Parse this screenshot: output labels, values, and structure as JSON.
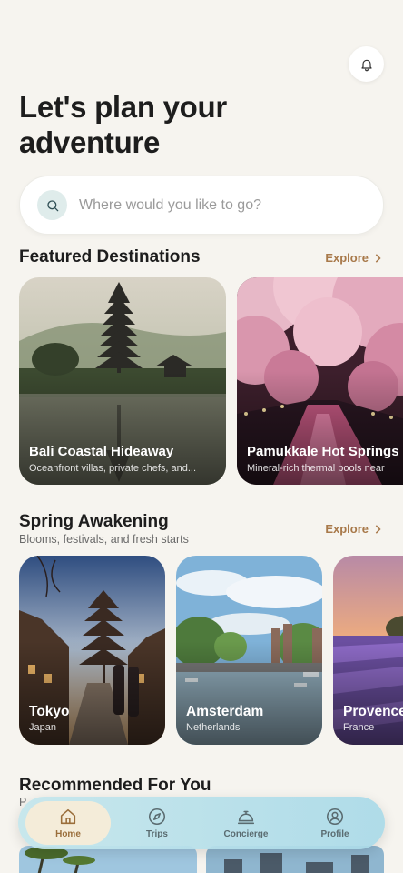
{
  "header": {
    "title": "Let's plan your adventure"
  },
  "search": {
    "placeholder": "Where would you like to go?"
  },
  "featured": {
    "title": "Featured Destinations",
    "explore_label": "Explore",
    "cards": [
      {
        "title": "Bali Coastal Hideaway",
        "subtitle": "Oceanfront villas, private chefs, and..."
      },
      {
        "title": "Pamukkale Hot Springs",
        "subtitle": "Mineral-rich thermal pools near"
      }
    ]
  },
  "spring": {
    "title": "Spring Awakening",
    "subtitle": "Blooms, festivals, and fresh starts",
    "explore_label": "Explore",
    "cards": [
      {
        "title": "Tokyo",
        "subtitle": "Japan"
      },
      {
        "title": "Amsterdam",
        "subtitle": "Netherlands"
      },
      {
        "title": "Provence",
        "subtitle": "France"
      }
    ]
  },
  "recommended": {
    "title": "Recommended For You",
    "subtitle": "P"
  },
  "tabbar": {
    "tabs": [
      {
        "label": "Home",
        "icon": "home-icon",
        "active": true
      },
      {
        "label": "Trips",
        "icon": "compass-icon",
        "active": false
      },
      {
        "label": "Concierge",
        "icon": "service-bell-icon",
        "active": false
      },
      {
        "label": "Profile",
        "icon": "user-icon",
        "active": false
      }
    ]
  },
  "colors": {
    "background": "#f6f4ef",
    "accent": "#a8794a",
    "tabbar": "#bfe3eb"
  }
}
